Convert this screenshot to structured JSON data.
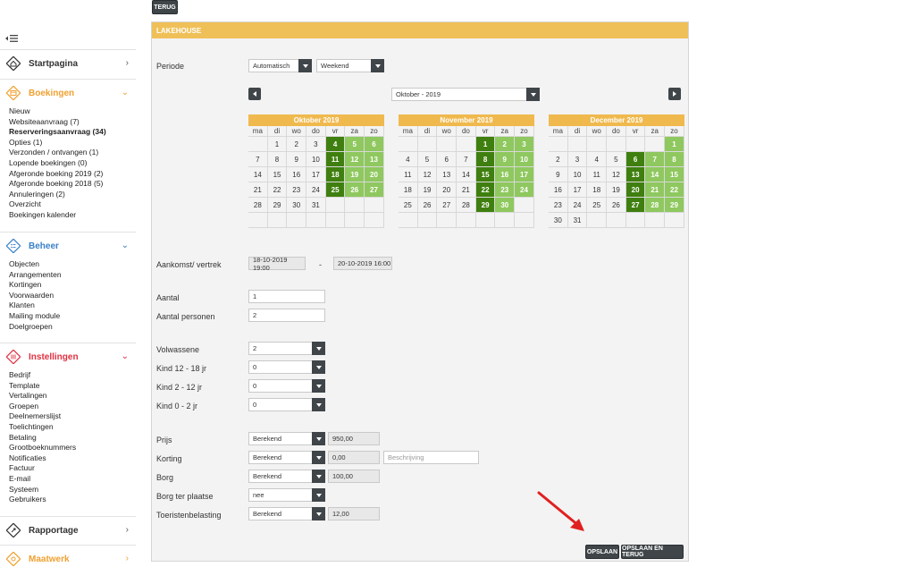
{
  "top": {
    "back_label": "TERUG"
  },
  "sidebar": {
    "toggle_icon": "menu-indent-icon",
    "sections": [
      {
        "title": "Startpagina",
        "icon": "home-icon",
        "color": "#333333",
        "expanded": false,
        "items": []
      },
      {
        "title": "Boekingen",
        "icon": "bookings-icon",
        "color": "#f0a030",
        "expanded": true,
        "items": [
          "Nieuw",
          "Websiteaanvraag (7)",
          "Reserveringsaanvraag (34)",
          "Opties (1)",
          "Verzonden / ontvangen (1)",
          "Lopende boekingen (0)",
          "Afgeronde boeking 2019 (2)",
          "Afgeronde boeking 2018 (5)",
          "Annuleringen (2)",
          "Overzicht",
          "Boekingen kalender"
        ]
      },
      {
        "title": "Beheer",
        "icon": "manage-icon",
        "color": "#3a80c8",
        "expanded": true,
        "items": [
          "Objecten",
          "Arrangementen",
          "Kortingen",
          "Voorwaarden",
          "Klanten",
          "Mailing module",
          "Doelgroepen"
        ]
      },
      {
        "title": "Instellingen",
        "icon": "settings-icon",
        "color": "#e03040",
        "expanded": true,
        "items": [
          "Bedrijf",
          "Template",
          "Vertalingen",
          "Groepen",
          "Deelnemerslijst",
          "Toelichtingen",
          "Betaling",
          "Grootboeknummers",
          "Notificaties",
          "Factuur",
          "E-mail",
          "Systeem",
          "Gebruikers"
        ]
      },
      {
        "title": "Rapportage",
        "icon": "report-icon",
        "color": "#333333",
        "expanded": false,
        "items": []
      },
      {
        "title": "Maatwerk",
        "icon": "custom-icon",
        "color": "#f0a030",
        "expanded": false,
        "items": []
      }
    ]
  },
  "panel": {
    "title": "LAKEHOUSE",
    "periode_label": "Periode",
    "periode_mode": "Automatisch",
    "periode_type": "Weekend",
    "month_select": "Oktober - 2019",
    "weekdays": [
      "ma",
      "di",
      "wo",
      "do",
      "vr",
      "za",
      "zo"
    ],
    "calendars": [
      {
        "name": "Oktober 2019",
        "rows": [
          [
            "",
            "1",
            "2",
            "3",
            "4",
            "5",
            "6"
          ],
          [
            "7",
            "8",
            "9",
            "10",
            "11",
            "12",
            "13"
          ],
          [
            "14",
            "15",
            "16",
            "17",
            "18",
            "19",
            "20"
          ],
          [
            "21",
            "22",
            "23",
            "24",
            "25",
            "26",
            "27"
          ],
          [
            "28",
            "29",
            "30",
            "31",
            "",
            "",
            ""
          ],
          [
            "",
            "",
            "",
            "",
            "",
            "",
            ""
          ]
        ],
        "dark": [
          "4",
          "11",
          "18",
          "25"
        ],
        "light": [
          "5",
          "6",
          "12",
          "13",
          "19",
          "20",
          "26",
          "27"
        ]
      },
      {
        "name": "November 2019",
        "rows": [
          [
            "",
            "",
            "",
            "",
            "1",
            "2",
            "3"
          ],
          [
            "4",
            "5",
            "6",
            "7",
            "8",
            "9",
            "10"
          ],
          [
            "11",
            "12",
            "13",
            "14",
            "15",
            "16",
            "17"
          ],
          [
            "18",
            "19",
            "20",
            "21",
            "22",
            "23",
            "24"
          ],
          [
            "25",
            "26",
            "27",
            "28",
            "29",
            "30",
            ""
          ],
          [
            "",
            "",
            "",
            "",
            "",
            "",
            ""
          ]
        ],
        "dark": [
          "1",
          "8",
          "15",
          "22",
          "29"
        ],
        "light": [
          "2",
          "3",
          "9",
          "10",
          "16",
          "17",
          "23",
          "24",
          "30"
        ]
      },
      {
        "name": "December 2019",
        "rows": [
          [
            "",
            "",
            "",
            "",
            "",
            "",
            "1"
          ],
          [
            "2",
            "3",
            "4",
            "5",
            "6",
            "7",
            "8"
          ],
          [
            "9",
            "10",
            "11",
            "12",
            "13",
            "14",
            "15"
          ],
          [
            "16",
            "17",
            "18",
            "19",
            "20",
            "21",
            "22"
          ],
          [
            "23",
            "24",
            "25",
            "26",
            "27",
            "28",
            "29"
          ],
          [
            "30",
            "31",
            "",
            "",
            "",
            "",
            ""
          ]
        ],
        "dark": [
          "6",
          "13",
          "20",
          "27"
        ],
        "light": [
          "1",
          "7",
          "8",
          "14",
          "15",
          "21",
          "22",
          "28",
          "29"
        ]
      }
    ],
    "aankomst_label": "Aankomst/ vertrek",
    "aankomst_value": "18-10-2019 19:00",
    "dash": "-",
    "vertrek_value": "20-10-2019 16:00",
    "aantal_label": "Aantal",
    "aantal_value": "1",
    "aantal_personen_label": "Aantal personen",
    "aantal_personen_value": "2",
    "volwassene_label": "Volwassene",
    "volwassene_value": "2",
    "kind12_label": "Kind 12 - 18 jr",
    "kind12_value": "0",
    "kind2_label": "Kind 2 - 12 jr",
    "kind2_value": "0",
    "kind0_label": "Kind 0 - 2 jr",
    "kind0_value": "0",
    "prijs_label": "Prijs",
    "prijs_mode": "Berekend",
    "prijs_value": "950,00",
    "korting_label": "Korting",
    "korting_mode": "Berekend",
    "korting_value": "0,00",
    "korting_desc_placeholder": "Beschrijving",
    "borg_label": "Borg",
    "borg_mode": "Berekend",
    "borg_value": "100,00",
    "borg_plaatse_label": "Borg ter plaatse",
    "borg_plaatse_value": "nee",
    "toeristen_label": "Toeristenbelasting",
    "toeristen_mode": "Berekend",
    "toeristen_value": "12,00",
    "save_label": "OPSLAAN",
    "save_back_label": "OPSLAAN EN TERUG"
  }
}
